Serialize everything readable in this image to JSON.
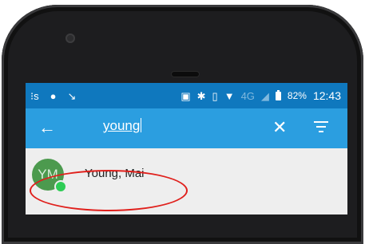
{
  "statusbar": {
    "left_icons": [
      "notification-icon",
      "android-icon",
      "missed-call-icon"
    ],
    "right_icons": [
      "nfc-icon",
      "bluetooth-icon",
      "vibrate-icon",
      "wifi-icon",
      "network-type-icon",
      "signal-icon",
      "battery-icon"
    ],
    "network_type": "4G",
    "battery": "82%",
    "time": "12:43"
  },
  "toolbar": {
    "search_value": "young",
    "back_icon": "arrow-left-icon",
    "clear_icon": "close-icon",
    "filter_icon": "filter-icon"
  },
  "results": [
    {
      "initials": "YM",
      "name": "Young, Mai",
      "presence": "online"
    }
  ],
  "colors": {
    "statusbar": "#0f78be",
    "toolbar": "#2b9ee0",
    "avatar": "#4c9a4e",
    "presence_online": "#2ecc55",
    "highlight": "#e0201c"
  }
}
